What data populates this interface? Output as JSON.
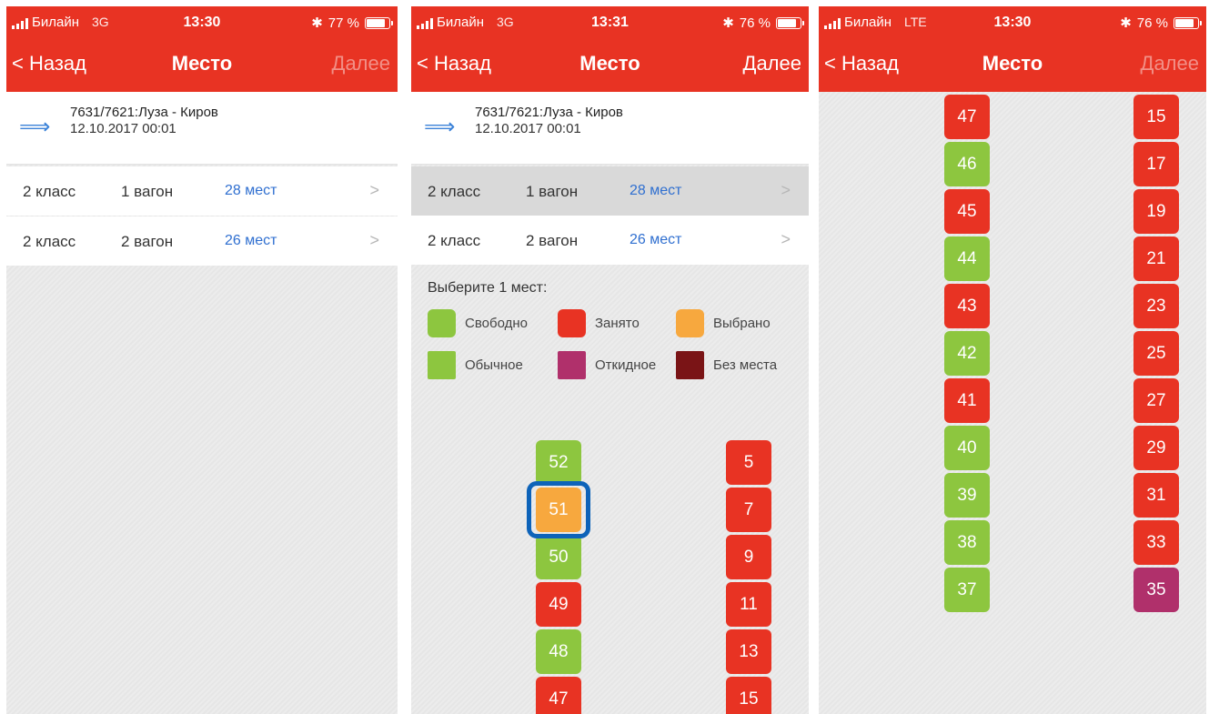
{
  "colors": {
    "bar": "#e83323",
    "free": "#8dc63f",
    "taken": "#e83323",
    "chosen": "#f7a83e",
    "folding": "#b0306b",
    "noseat": "#7a1416",
    "link": "#2f6fd0"
  },
  "screens": [
    {
      "status": {
        "carrier": "Билайн",
        "network": "3G",
        "time": "13:30",
        "battery": "77 %",
        "battery_level": 0.77
      },
      "nav": {
        "back": "< Назад",
        "title": "Место",
        "next": "Далее"
      },
      "train": {
        "route": "7631/7621:Луза - Киров",
        "date": "12.10.2017 00:01"
      },
      "wagons": [
        {
          "class": "2 класс",
          "number": "1 вагон",
          "seats": "28 мест"
        },
        {
          "class": "2 класс",
          "number": "2 вагон",
          "seats": "26 мест"
        }
      ]
    },
    {
      "status": {
        "carrier": "Билайн",
        "network": "3G",
        "time": "13:31",
        "battery": "76 %",
        "battery_level": 0.76
      },
      "nav": {
        "back": "< Назад",
        "title": "Место",
        "next": "Далее"
      },
      "train": {
        "route": "7631/7621:Луза - Киров",
        "date": "12.10.2017 00:01"
      },
      "wagons": [
        {
          "class": "2 класс",
          "number": "1 вагон",
          "seats": "28 мест"
        },
        {
          "class": "2 класс",
          "number": "2 вагон",
          "seats": "26 мест"
        }
      ],
      "prompt": "Выберите 1 мест:",
      "legend": {
        "free": "Свободно",
        "taken": "Занято",
        "chosen": "Выбрано",
        "regular": "Обычное",
        "folding": "Откидное",
        "noseat": "Без места"
      },
      "seats_left": [
        {
          "n": "52",
          "s": "free"
        },
        {
          "n": "51",
          "s": "chosen"
        },
        {
          "n": "50",
          "s": "free"
        },
        {
          "n": "49",
          "s": "taken"
        },
        {
          "n": "48",
          "s": "free"
        },
        {
          "n": "47",
          "s": "taken"
        }
      ],
      "seats_right": [
        {
          "n": "5",
          "s": "taken"
        },
        {
          "n": "7",
          "s": "taken"
        },
        {
          "n": "9",
          "s": "taken"
        },
        {
          "n": "11",
          "s": "taken"
        },
        {
          "n": "13",
          "s": "taken"
        },
        {
          "n": "15",
          "s": "taken"
        }
      ]
    },
    {
      "status": {
        "carrier": "Билайн",
        "network": "LTE",
        "time": "13:30",
        "battery": "76 %",
        "battery_level": 0.76
      },
      "nav": {
        "back": "< Назад",
        "title": "Место",
        "next": "Далее"
      },
      "seats_left": [
        {
          "n": "47",
          "s": "taken"
        },
        {
          "n": "46",
          "s": "free"
        },
        {
          "n": "45",
          "s": "taken"
        },
        {
          "n": "44",
          "s": "free"
        },
        {
          "n": "43",
          "s": "taken"
        },
        {
          "n": "42",
          "s": "free"
        },
        {
          "n": "41",
          "s": "taken"
        },
        {
          "n": "40",
          "s": "free"
        },
        {
          "n": "39",
          "s": "free"
        },
        {
          "n": "38",
          "s": "free"
        },
        {
          "n": "37",
          "s": "free"
        }
      ],
      "seats_right": [
        {
          "n": "15",
          "s": "taken"
        },
        {
          "n": "17",
          "s": "taken"
        },
        {
          "n": "19",
          "s": "taken"
        },
        {
          "n": "21",
          "s": "taken"
        },
        {
          "n": "23",
          "s": "taken"
        },
        {
          "n": "25",
          "s": "taken"
        },
        {
          "n": "27",
          "s": "taken"
        },
        {
          "n": "29",
          "s": "taken"
        },
        {
          "n": "31",
          "s": "taken"
        },
        {
          "n": "33",
          "s": "taken"
        },
        {
          "n": "35",
          "s": "folding"
        }
      ]
    }
  ]
}
